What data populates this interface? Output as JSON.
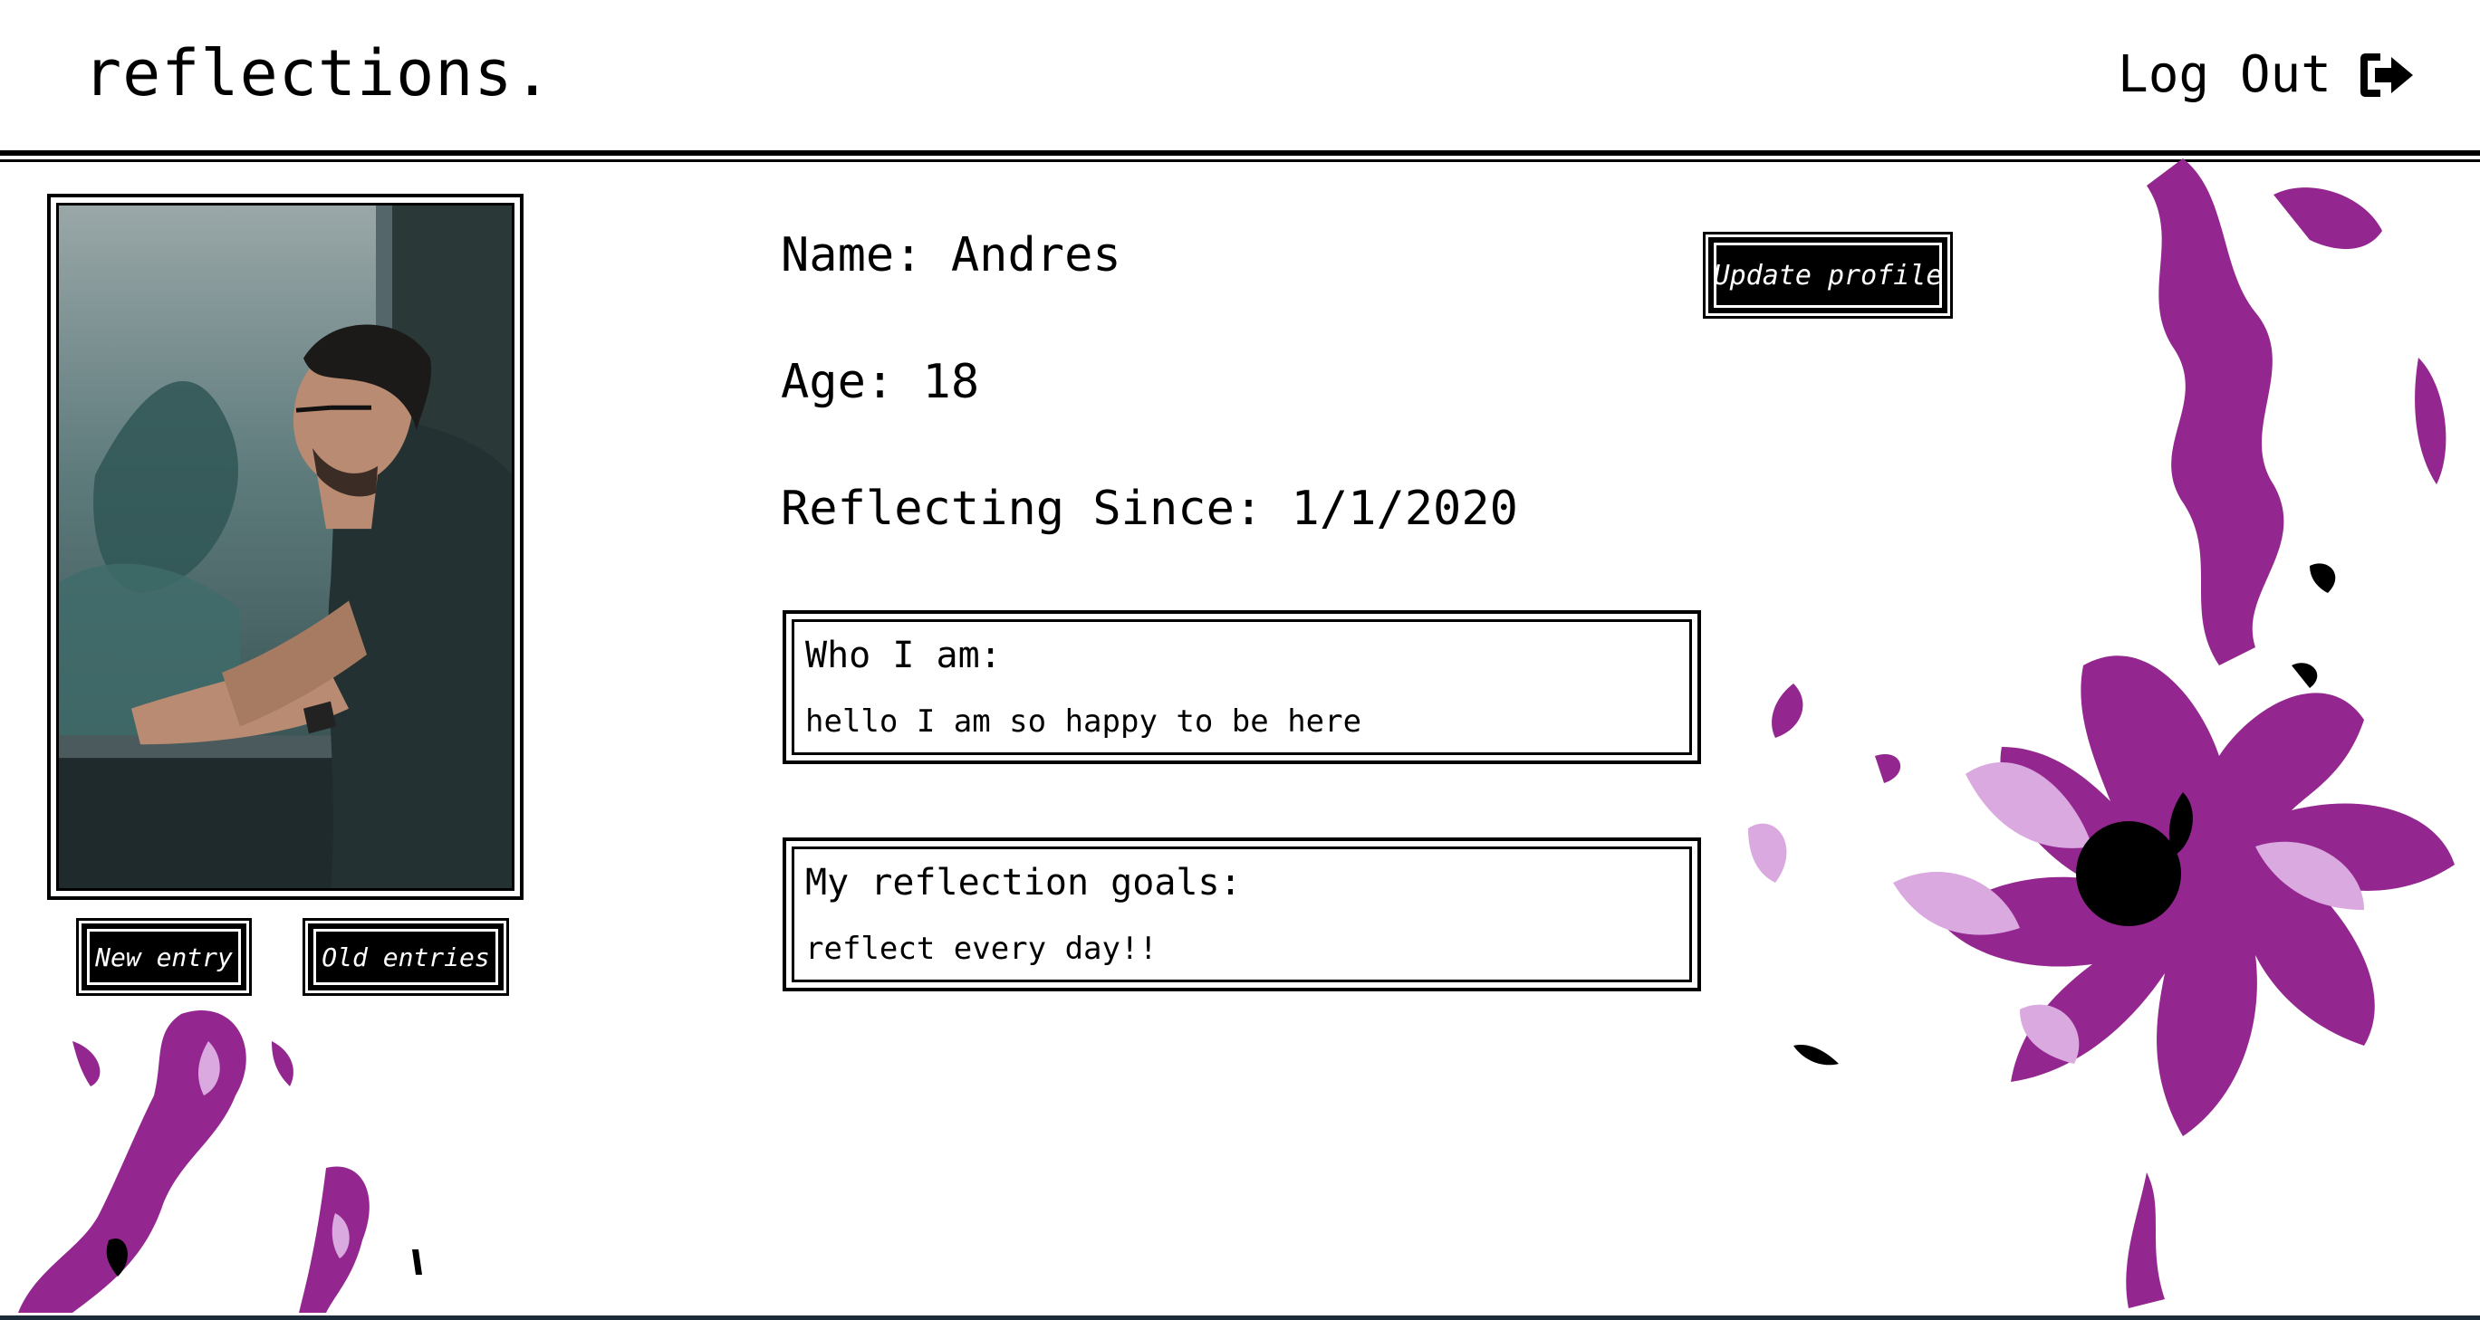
{
  "header": {
    "brand": "reflections.",
    "logout_label": "Log Out",
    "logout_icon": "sign-out-icon"
  },
  "sidebar": {
    "photo_icon": "profile-photo",
    "new_entry_label": "New entry",
    "old_entries_label": "Old entries"
  },
  "profile": {
    "name_line": "Name: Andres",
    "age_line": "Age: 18",
    "since_line": "Reflecting Since: 1/1/2020",
    "update_label": "Update profile"
  },
  "about": {
    "title": "Who I am:",
    "text": "hello I am so happy to be here"
  },
  "goals": {
    "title": "My reflection goals:",
    "text": "reflect every day!!"
  },
  "colors": {
    "accent_purple": "#93278f",
    "light_purple": "#d9a9e0",
    "ink": "#000000"
  }
}
